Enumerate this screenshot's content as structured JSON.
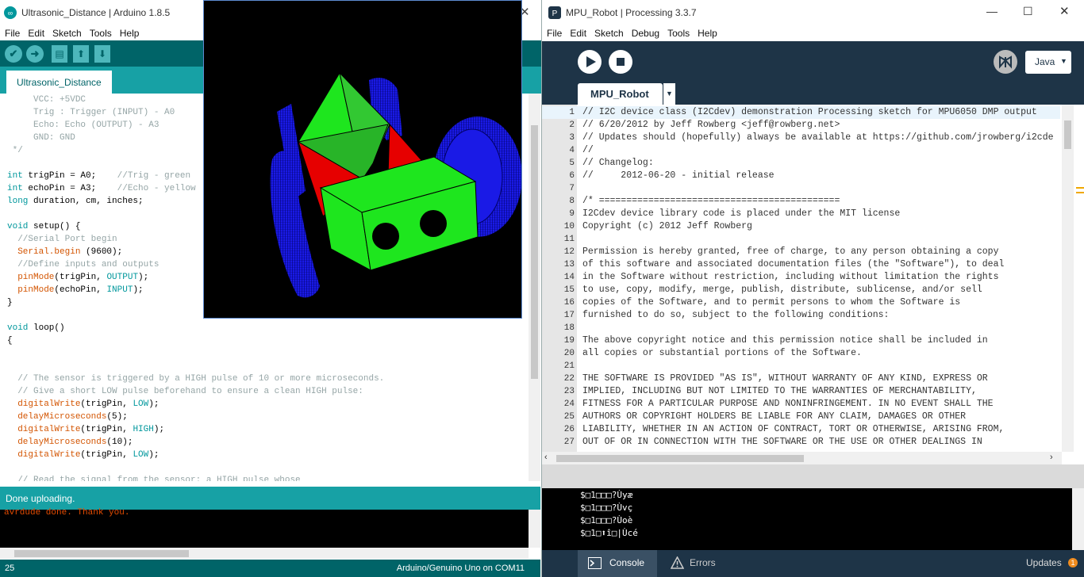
{
  "arduino": {
    "window_title": "Ultrasonic_Distance | Arduino 1.8.5",
    "menu": [
      "File",
      "Edit",
      "Sketch",
      "Tools",
      "Help"
    ],
    "tab_label": "Ultrasonic_Distance",
    "code_lines": [
      {
        "text": "     VCC: +5VDC",
        "cls": "cm"
      },
      {
        "text": "     Trig : Trigger (INPUT) - A0",
        "cls": "cm"
      },
      {
        "text": "     Echo: Echo (OUTPUT) - A3",
        "cls": "cm"
      },
      {
        "text": "     GND: GND",
        "cls": "cm"
      },
      {
        "text": " */",
        "cls": "cm"
      },
      {
        "text": "",
        "cls": ""
      },
      {
        "text": "int trigPin = A0;    //Trig - green",
        "cls": ""
      },
      {
        "text": "int echoPin = A3;    //Echo - yellow",
        "cls": ""
      },
      {
        "text": "long duration, cm, inches;",
        "cls": ""
      },
      {
        "text": "",
        "cls": ""
      },
      {
        "text": "void setup() {",
        "cls": ""
      },
      {
        "text": "  //Serial Port begin",
        "cls": ""
      },
      {
        "text": "  Serial.begin (9600);",
        "cls": ""
      },
      {
        "text": "  //Define inputs and outputs",
        "cls": ""
      },
      {
        "text": "  pinMode(trigPin, OUTPUT);",
        "cls": ""
      },
      {
        "text": "  pinMode(echoPin, INPUT);",
        "cls": ""
      },
      {
        "text": "}",
        "cls": ""
      },
      {
        "text": "",
        "cls": ""
      },
      {
        "text": "void loop()",
        "cls": ""
      },
      {
        "text": "{",
        "cls": ""
      },
      {
        "text": "",
        "cls": ""
      },
      {
        "text": "",
        "cls": ""
      },
      {
        "text": "  // The sensor is triggered by a HIGH pulse of 10 or more microseconds.",
        "cls": "cm"
      },
      {
        "text": "  // Give a short LOW pulse beforehand to ensure a clean HIGH pulse:",
        "cls": "cm"
      },
      {
        "text": "  digitalWrite(trigPin, LOW);",
        "cls": ""
      },
      {
        "text": "  delayMicroseconds(5);",
        "cls": ""
      },
      {
        "text": "  digitalWrite(trigPin, HIGH);",
        "cls": ""
      },
      {
        "text": "  delayMicroseconds(10);",
        "cls": ""
      },
      {
        "text": "  digitalWrite(trigPin, LOW);",
        "cls": ""
      },
      {
        "text": "",
        "cls": ""
      },
      {
        "text": "  // Read the signal from the sensor: a HIGH pulse whose",
        "cls": "cm"
      }
    ],
    "status_text": "Done uploading.",
    "console_text": "avrdude done.  Thank you.",
    "line_number": "25",
    "board_info": "Arduino/Genuino Uno on COM11",
    "colors": {
      "teal_dark": "#006468",
      "teal": "#17a1a5",
      "console_orange": "#e34c00"
    }
  },
  "processing": {
    "window_title": "MPU_Robot | Processing 3.3.7",
    "menu": [
      "File",
      "Edit",
      "Sketch",
      "Debug",
      "Tools",
      "Help"
    ],
    "mode": "Java",
    "tab_label": "MPU_Robot",
    "code_lines": [
      "// I2C device class (I2Cdev) demonstration Processing sketch for MPU6050 DMP output",
      "// 6/20/2012 by Jeff Rowberg <jeff@rowberg.net>",
      "// Updates should (hopefully) always be available at https://github.com/jrowberg/i2cde",
      "//",
      "// Changelog:",
      "//     2012-06-20 - initial release",
      "",
      "/* ============================================",
      "I2Cdev device library code is placed under the MIT license",
      "Copyright (c) 2012 Jeff Rowberg",
      "",
      "Permission is hereby granted, free of charge, to any person obtaining a copy",
      "of this software and associated documentation files (the \"Software\"), to deal",
      "in the Software without restriction, including without limitation the rights",
      "to use, copy, modify, merge, publish, distribute, sublicense, and/or sell",
      "copies of the Software, and to permit persons to whom the Software is",
      "furnished to do so, subject to the following conditions:",
      "",
      "The above copyright notice and this permission notice shall be included in",
      "all copies or substantial portions of the Software.",
      "",
      "THE SOFTWARE IS PROVIDED \"AS IS\", WITHOUT WARRANTY OF ANY KIND, EXPRESS OR",
      "IMPLIED, INCLUDING BUT NOT LIMITED TO THE WARRANTIES OF MERCHANTABILITY,",
      "FITNESS FOR A PARTICULAR PURPOSE AND NONINFRINGEMENT. IN NO EVENT SHALL THE",
      "AUTHORS OR COPYRIGHT HOLDERS BE LIABLE FOR ANY CLAIM, DAMAGES OR OTHER",
      "LIABILITY, WHETHER IN AN ACTION OF CONTRACT, TORT OR OTHERWISE, ARISING FROM,",
      "OUT OF OR IN CONNECTION WITH THE SOFTWARE OR THE USE OR OTHER DEALINGS IN"
    ],
    "console_lines": [
      "$□1□□□?Ùyæ",
      "$□1□□□?Ùvç",
      "$□1□□□?Ùoè",
      "$□1□⬆î□|Ùcé"
    ],
    "console_tab": "Console",
    "errors_tab": "Errors",
    "updates_label": "Updates",
    "updates_count": "1",
    "colors": {
      "toolbar": "#1e3447",
      "updates_badge": "#f08c1e"
    }
  }
}
